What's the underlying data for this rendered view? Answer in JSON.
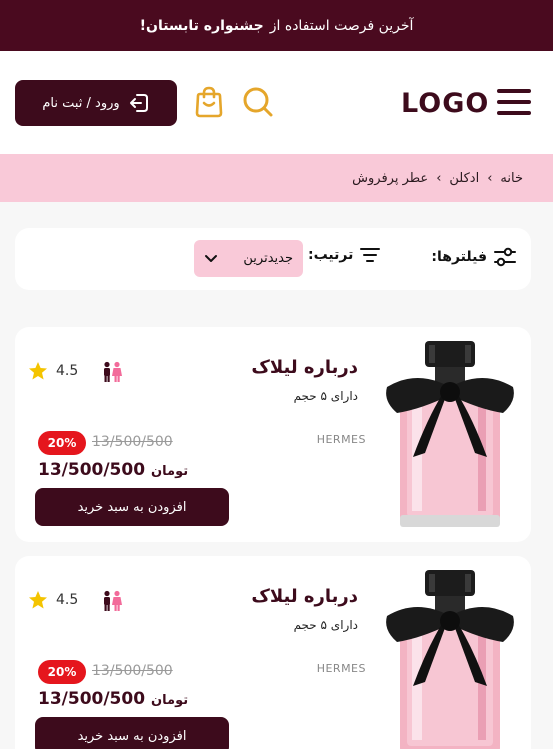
{
  "promo": {
    "text": "آخرین فرصت استفاده از",
    "highlight": "جشنواره تابستان!"
  },
  "header": {
    "logo": "LOGO",
    "login_label": "ورود / ثبت نام"
  },
  "breadcrumb": {
    "items": [
      "خانه",
      "ادکلن",
      "عطر پرفروش"
    ],
    "separator": "›"
  },
  "toolbar": {
    "filters_label": "فیلترها:",
    "sort_label": "ترتیب:",
    "sort_value": "جدیدترین"
  },
  "products": [
    {
      "title": "درباره لیلاک",
      "subtitle": "دارای ۵ حجم",
      "brand": "HERMES",
      "rating": "4.5",
      "discount": "20%",
      "old_price": "13/500/500",
      "price": "13/500/500",
      "currency": "تومان",
      "add_label": "افزودن به سبد خرید"
    },
    {
      "title": "درباره لیلاک",
      "subtitle": "دارای ۵ حجم",
      "brand": "HERMES",
      "rating": "4.5",
      "discount": "20%",
      "old_price": "13/500/500",
      "price": "13/500/500",
      "currency": "تومان",
      "add_label": "افزودن به سبد خرید"
    }
  ],
  "colors": {
    "primary": "#3d0b1c",
    "accent_pink": "#f9c9d8",
    "gold": "#e5a62b",
    "discount_red": "#e5161d",
    "star": "#f4c400"
  }
}
